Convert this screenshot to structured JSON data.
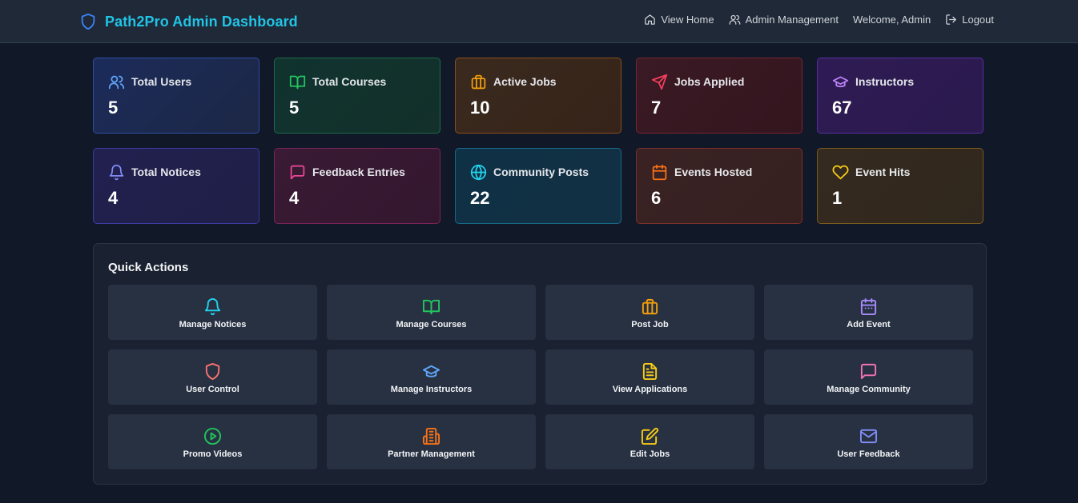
{
  "header": {
    "title": "Path2Pro Admin Dashboard",
    "nav": {
      "view_home": "View Home",
      "admin_management": "Admin Management",
      "welcome": "Welcome, Admin",
      "logout": "Logout"
    }
  },
  "stats": [
    {
      "label": "Total Users",
      "value": "5",
      "icon": "users-icon",
      "color": "#60a5fa"
    },
    {
      "label": "Total Courses",
      "value": "5",
      "icon": "book-icon",
      "color": "#22c55e"
    },
    {
      "label": "Active Jobs",
      "value": "10",
      "icon": "briefcase-icon",
      "color": "#f59e0b"
    },
    {
      "label": "Jobs Applied",
      "value": "7",
      "icon": "send-icon",
      "color": "#f43f5e"
    },
    {
      "label": "Instructors",
      "value": "67",
      "icon": "graduation-cap-icon",
      "color": "#c084fc"
    },
    {
      "label": "Total Notices",
      "value": "4",
      "icon": "bell-icon",
      "color": "#818cf8"
    },
    {
      "label": "Feedback Entries",
      "value": "4",
      "icon": "message-icon",
      "color": "#ec4899"
    },
    {
      "label": "Community Posts",
      "value": "22",
      "icon": "globe-icon",
      "color": "#22d3ee"
    },
    {
      "label": "Events Hosted",
      "value": "6",
      "icon": "calendar-icon",
      "color": "#f97316"
    },
    {
      "label": "Event Hits",
      "value": "1",
      "icon": "heart-icon",
      "color": "#facc15"
    }
  ],
  "quick_actions": {
    "title": "Quick Actions",
    "items": [
      {
        "label": "Manage Notices",
        "icon": "bell-icon",
        "color": "#22d3ee"
      },
      {
        "label": "Manage Courses",
        "icon": "book-icon",
        "color": "#22c55e"
      },
      {
        "label": "Post Job",
        "icon": "briefcase-icon",
        "color": "#f59e0b"
      },
      {
        "label": "Add Event",
        "icon": "calendar-icon",
        "color": "#a78bfa"
      },
      {
        "label": "User Control",
        "icon": "shield-icon",
        "color": "#f87171"
      },
      {
        "label": "Manage Instructors",
        "icon": "graduation-cap-icon",
        "color": "#60a5fa"
      },
      {
        "label": "View Applications",
        "icon": "file-text-icon",
        "color": "#facc15"
      },
      {
        "label": "Manage Community",
        "icon": "message-icon",
        "color": "#f472b6"
      },
      {
        "label": "Promo Videos",
        "icon": "play-circle-icon",
        "color": "#22c55e"
      },
      {
        "label": "Partner Management",
        "icon": "building-icon",
        "color": "#f97316"
      },
      {
        "label": "Edit Jobs",
        "icon": "edit-icon",
        "color": "#facc15"
      },
      {
        "label": "User Feedback",
        "icon": "mail-icon",
        "color": "#818cf8"
      }
    ]
  }
}
